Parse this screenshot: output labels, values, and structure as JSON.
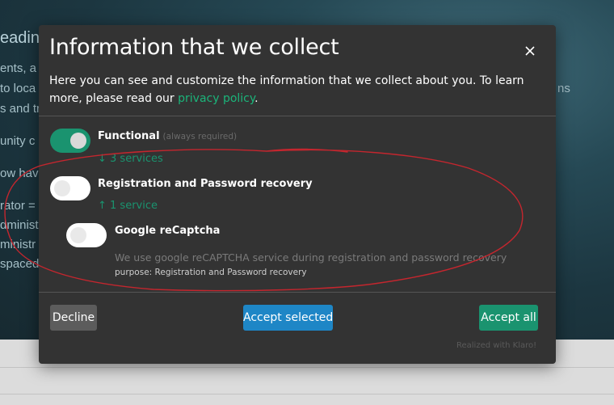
{
  "background": {
    "lines": [
      "eadin",
      "ents, a",
      "to loca",
      "s and tr",
      "unity c",
      "ow hav",
      "rator =",
      "dminist",
      "ministr",
      "spaced"
    ],
    "right_fragment": "ns"
  },
  "modal": {
    "title": "Information that we collect",
    "close_label": "×",
    "description_before": "Here you can see and customize the information that we collect about you. To learn more, please read our ",
    "privacy_link": "privacy policy",
    "description_after": "."
  },
  "services": {
    "functional": {
      "name": "Functional",
      "required_note": "(always required)",
      "count": "↓ 3 services",
      "enabled": true
    },
    "registration": {
      "name": "Registration and Password recovery",
      "count": "↑ 1 service",
      "enabled": false
    },
    "recaptcha": {
      "name": "Google reCaptcha",
      "description": "We use google reCAPTCHA service during registration and password recovery",
      "purpose": "purpose: Registration and Password recovery",
      "enabled": false
    }
  },
  "buttons": {
    "decline": "Decline",
    "accept_selected": "Accept selected",
    "accept_all": "Accept all"
  },
  "footer": {
    "powered_by": "Realized with Klaro!"
  },
  "colors": {
    "accent_green": "#1a936f",
    "accept_selected_blue": "#1e86c6",
    "annotation_red": "#c4262e"
  },
  "icons": {
    "close": "close-icon"
  }
}
